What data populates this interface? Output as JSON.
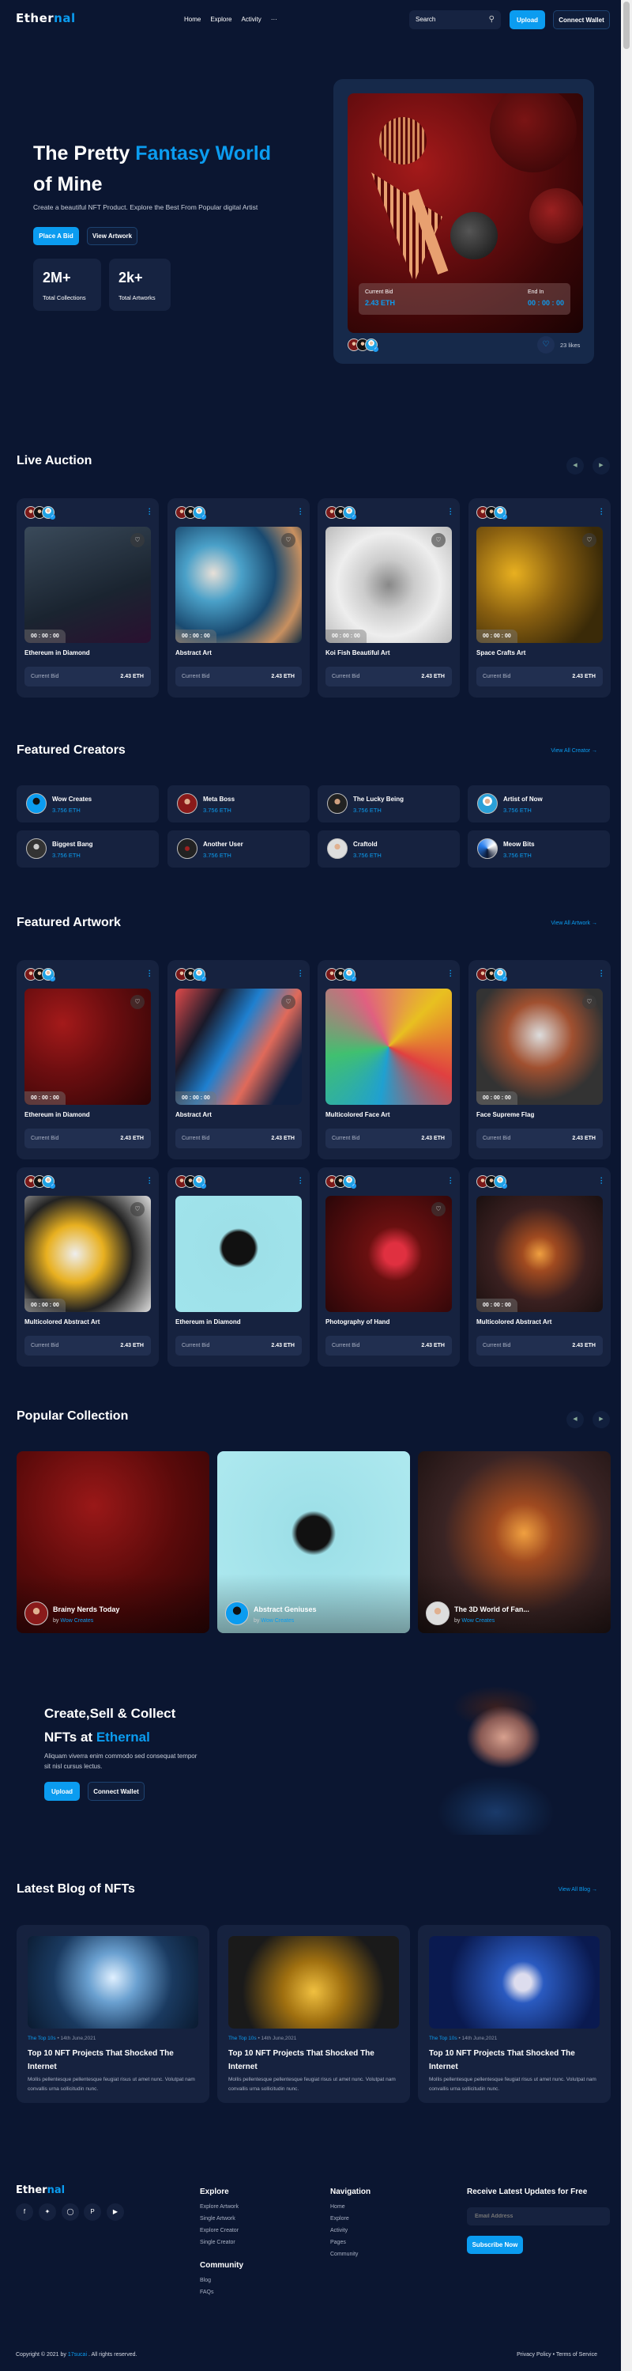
{
  "header": {
    "logo_a": "Ether",
    "logo_b": "nal",
    "nav": [
      "Home",
      "Explore",
      "Activity",
      "···"
    ],
    "search_placeholder": "Search",
    "upload": "Upload",
    "connect_wallet": "Connect Wallet"
  },
  "hero": {
    "title_a": "The Pretty ",
    "title_highlight": "Fantasy World",
    "title_b": "of Mine",
    "subtitle": "Create a beautiful NFT Product. Explore the Best From Popular digital Artist",
    "place_bid": "Place A Bid",
    "view_artwork": "View Artwork",
    "stats": [
      {
        "value": "2M+",
        "label": "Total Collections"
      },
      {
        "value": "2k+",
        "label": "Total Artworks"
      }
    ],
    "card": {
      "current_bid_label": "Current Bid",
      "current_bid": "2.43 ETH",
      "end_in_label": "End In",
      "end_in": "00 : 00 : 00",
      "likes": "23 likes"
    }
  },
  "live_auction": {
    "title": "Live Auction",
    "cards": [
      {
        "name": "Ethereum in Diamond",
        "timer": "00 : 00 : 00",
        "bid_label": "Current Bid",
        "bid": "2.43 ETH"
      },
      {
        "name": "Abstract Art",
        "timer": "00 : 00 : 00",
        "bid_label": "Current Bid",
        "bid": "2.43 ETH"
      },
      {
        "name": "Koi Fish Beautiful Art",
        "timer": "00 : 00 : 00",
        "bid_label": "Current Bid",
        "bid": "2.43 ETH"
      },
      {
        "name": "Space Crafts Art",
        "timer": "00 : 00 : 00",
        "bid_label": "Current Bid",
        "bid": "2.43 ETH"
      }
    ]
  },
  "featured_creators": {
    "title": "Featured Creators",
    "view_all": "View All Creator",
    "creators": [
      {
        "name": "Wow Creates",
        "eth": "3.756 ETH"
      },
      {
        "name": "Meta Boss",
        "eth": "3.756 ETH"
      },
      {
        "name": "The Lucky Being",
        "eth": "3.756 ETH"
      },
      {
        "name": "Artist of Now",
        "eth": "3.756 ETH"
      },
      {
        "name": "Biggest Bang",
        "eth": "3.756 ETH"
      },
      {
        "name": "Another User",
        "eth": "3.756 ETH"
      },
      {
        "name": "Craftold",
        "eth": "3.756 ETH"
      },
      {
        "name": "Meow Bits",
        "eth": "3.756 ETH"
      }
    ]
  },
  "featured_artwork": {
    "title": "Featured Artwork",
    "view_all": "View All Artwork",
    "cards": [
      {
        "name": "Ethereum in Diamond",
        "timer": "00 : 00 : 00",
        "bid_label": "Current Bid",
        "bid": "2.43 ETH"
      },
      {
        "name": "Abstract Art",
        "timer": "00 : 00 : 00",
        "bid_label": "Current Bid",
        "bid": "2.43 ETH"
      },
      {
        "name": "Multicolored Face Art",
        "timer": "",
        "bid_label": "Current Bid",
        "bid": "2.43 ETH"
      },
      {
        "name": "Face Supreme Flag",
        "timer": "00 : 00 : 00",
        "bid_label": "Current Bid",
        "bid": "2.43 ETH"
      },
      {
        "name": "Multicolored Abstract Art",
        "timer": "00 : 00 : 00",
        "bid_label": "Current Bid",
        "bid": "2.43 ETH"
      },
      {
        "name": "Ethereum in Diamond",
        "timer": "",
        "bid_label": "Current Bid",
        "bid": "2.43 ETH"
      },
      {
        "name": "Photography of Hand",
        "timer": "",
        "bid_label": "Current Bid",
        "bid": "2.43 ETH"
      },
      {
        "name": "Multicolored Abstract Art",
        "timer": "00 : 00 : 00",
        "bid_label": "Current Bid",
        "bid": "2.43 ETH"
      }
    ]
  },
  "popular_collection": {
    "title": "Popular Collection",
    "items": [
      {
        "title": "Brainy Nerds Today",
        "by": "by",
        "creator": "Wow Creates"
      },
      {
        "title": "Abstract Geniuses",
        "by": "by",
        "creator": "Wow Creates"
      },
      {
        "title": "The 3D World of Fan...",
        "by": "by",
        "creator": "Wow Creates"
      }
    ]
  },
  "cta": {
    "title_a": "Create,Sell & Collect",
    "title_b": "NFTs at ",
    "title_highlight": "Ethernal",
    "subtitle": "Aliquam viverra enim commodo sed consequat tempor sit nisl cursus lectus.",
    "upload": "Upload",
    "connect_wallet": "Connect Wallet"
  },
  "blog": {
    "title": "Latest Blog of NFTs",
    "view_all": "View All Blog",
    "posts": [
      {
        "category": "The Top 10s",
        "date": "14th June,2021",
        "title": "Top 10 NFT Projects That Shocked The Internet",
        "excerpt": "Mollis pellentesque pellentesque feugiat risus ut amet nunc. Volutpat nam convallis urna sollicitudin nunc."
      },
      {
        "category": "The Top 10s",
        "date": "14th June,2021",
        "title": "Top 10 NFT Projects That Shocked The Internet",
        "excerpt": "Mollis pellentesque pellentesque feugiat risus ut amet nunc. Volutpat nam convallis urna sollicitudin nunc."
      },
      {
        "category": "The Top 10s",
        "date": "14th June,2021",
        "title": "Top 10 NFT Projects That Shocked The Internet",
        "excerpt": "Mollis pellentesque pellentesque feugiat risus ut amet nunc. Volutpat nam convallis urna sollicitudin nunc."
      }
    ]
  },
  "footer": {
    "logo_a": "Ether",
    "logo_b": "nal",
    "social": [
      "facebook",
      "twitter",
      "instagram",
      "pinterest",
      "youtube"
    ],
    "explore_title": "Explore",
    "explore_links": [
      "Explore Artwork",
      "Single Artwork",
      "Explore Creator",
      "Single Creator"
    ],
    "community_title": "Community",
    "community_links": [
      "Blog",
      "FAQs"
    ],
    "navigation_title": "Navigation",
    "navigation_links": [
      "Home",
      "Explore",
      "Activity",
      "Pages",
      "Community"
    ],
    "newsletter_title": "Receive Latest Updates for Free",
    "email_placeholder": "Email Address",
    "subscribe": "Subscribe Now",
    "copyright_a": "Copyright © 2021 by ",
    "copyright_link": "17sucai",
    "copyright_b": " . All rights reserved.",
    "legal": "Privacy Policy • Terms of Service"
  },
  "colors": {
    "background": "#0b1631",
    "card": "#16223f",
    "accent": "#0b9cf0"
  }
}
